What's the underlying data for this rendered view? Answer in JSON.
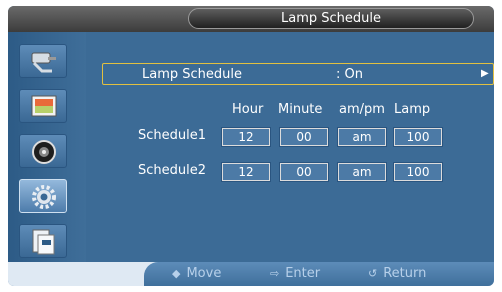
{
  "window": {
    "title": "Lamp Schedule"
  },
  "sidebar": {
    "items": [
      {
        "icon": "input-source-icon",
        "active": false
      },
      {
        "icon": "picture-icon",
        "active": false
      },
      {
        "icon": "sound-icon",
        "active": false
      },
      {
        "icon": "setup-gear-icon",
        "active": true
      },
      {
        "icon": "multi-control-icon",
        "active": false
      }
    ]
  },
  "lamp_schedule": {
    "label": "Lamp Schedule",
    "value": ": On",
    "arrow": "▶"
  },
  "columns": [
    "Hour",
    "Minute",
    "am/pm",
    "Lamp"
  ],
  "schedules": [
    {
      "label": "Schedule1",
      "hour": "12",
      "minute": "00",
      "ampm": "am",
      "lamp": "100"
    },
    {
      "label": "Schedule2",
      "hour": "12",
      "minute": "00",
      "ampm": "am",
      "lamp": "100"
    }
  ],
  "footer": {
    "move": {
      "icon": "◆",
      "label": "Move"
    },
    "enter": {
      "icon": "⇨",
      "label": "Enter"
    },
    "return": {
      "icon": "↺",
      "label": "Return"
    }
  },
  "colors": {
    "panel": "#3c6b96",
    "highlight": "#e2c040",
    "footer_text": "#b7d0ea"
  }
}
